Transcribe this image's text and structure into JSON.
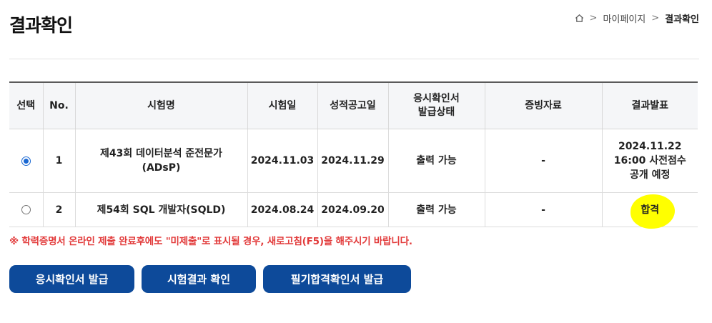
{
  "page": {
    "title": "결과확인",
    "breadcrumb": {
      "home_icon": "home-icon",
      "items": [
        "마이페이지",
        "결과확인"
      ]
    }
  },
  "table": {
    "headers": [
      "선택",
      "No.",
      "시험명",
      "시험일",
      "성적공고일",
      "응시확인서\n발급상태",
      "증빙자료",
      "결과발표"
    ],
    "rows": [
      {
        "selected": true,
        "no": "1",
        "exam_name": "제43회 데이터분석 준전문가\n(ADsP)",
        "exam_date": "2024.11.03",
        "score_date": "2024.11.29",
        "cert_status": "출력 가능",
        "evidence": "-",
        "result": "2024.11.22\n16:00 사전점수\n공개 예정",
        "highlighted": false
      },
      {
        "selected": false,
        "no": "2",
        "exam_name": "제54회 SQL 개발자(SQLD)",
        "exam_date": "2024.08.24",
        "score_date": "2024.09.20",
        "cert_status": "출력 가능",
        "evidence": "-",
        "result": "합격",
        "highlighted": true
      }
    ]
  },
  "notice": "※ 학력증명서 온라인 제출 완료후에도 \"미제출\"로 표시될 경우, 새로고침(F5)을 해주시기 바랍니다.",
  "buttons": {
    "cert_issue": "응시확인서 발급",
    "result_check": "시험결과 확인",
    "written_pass_issue": "필기합격확인서 발급"
  },
  "colors": {
    "primary": "#0d4a9a",
    "notice": "#e23b3b",
    "highlight": "#ffff00"
  }
}
